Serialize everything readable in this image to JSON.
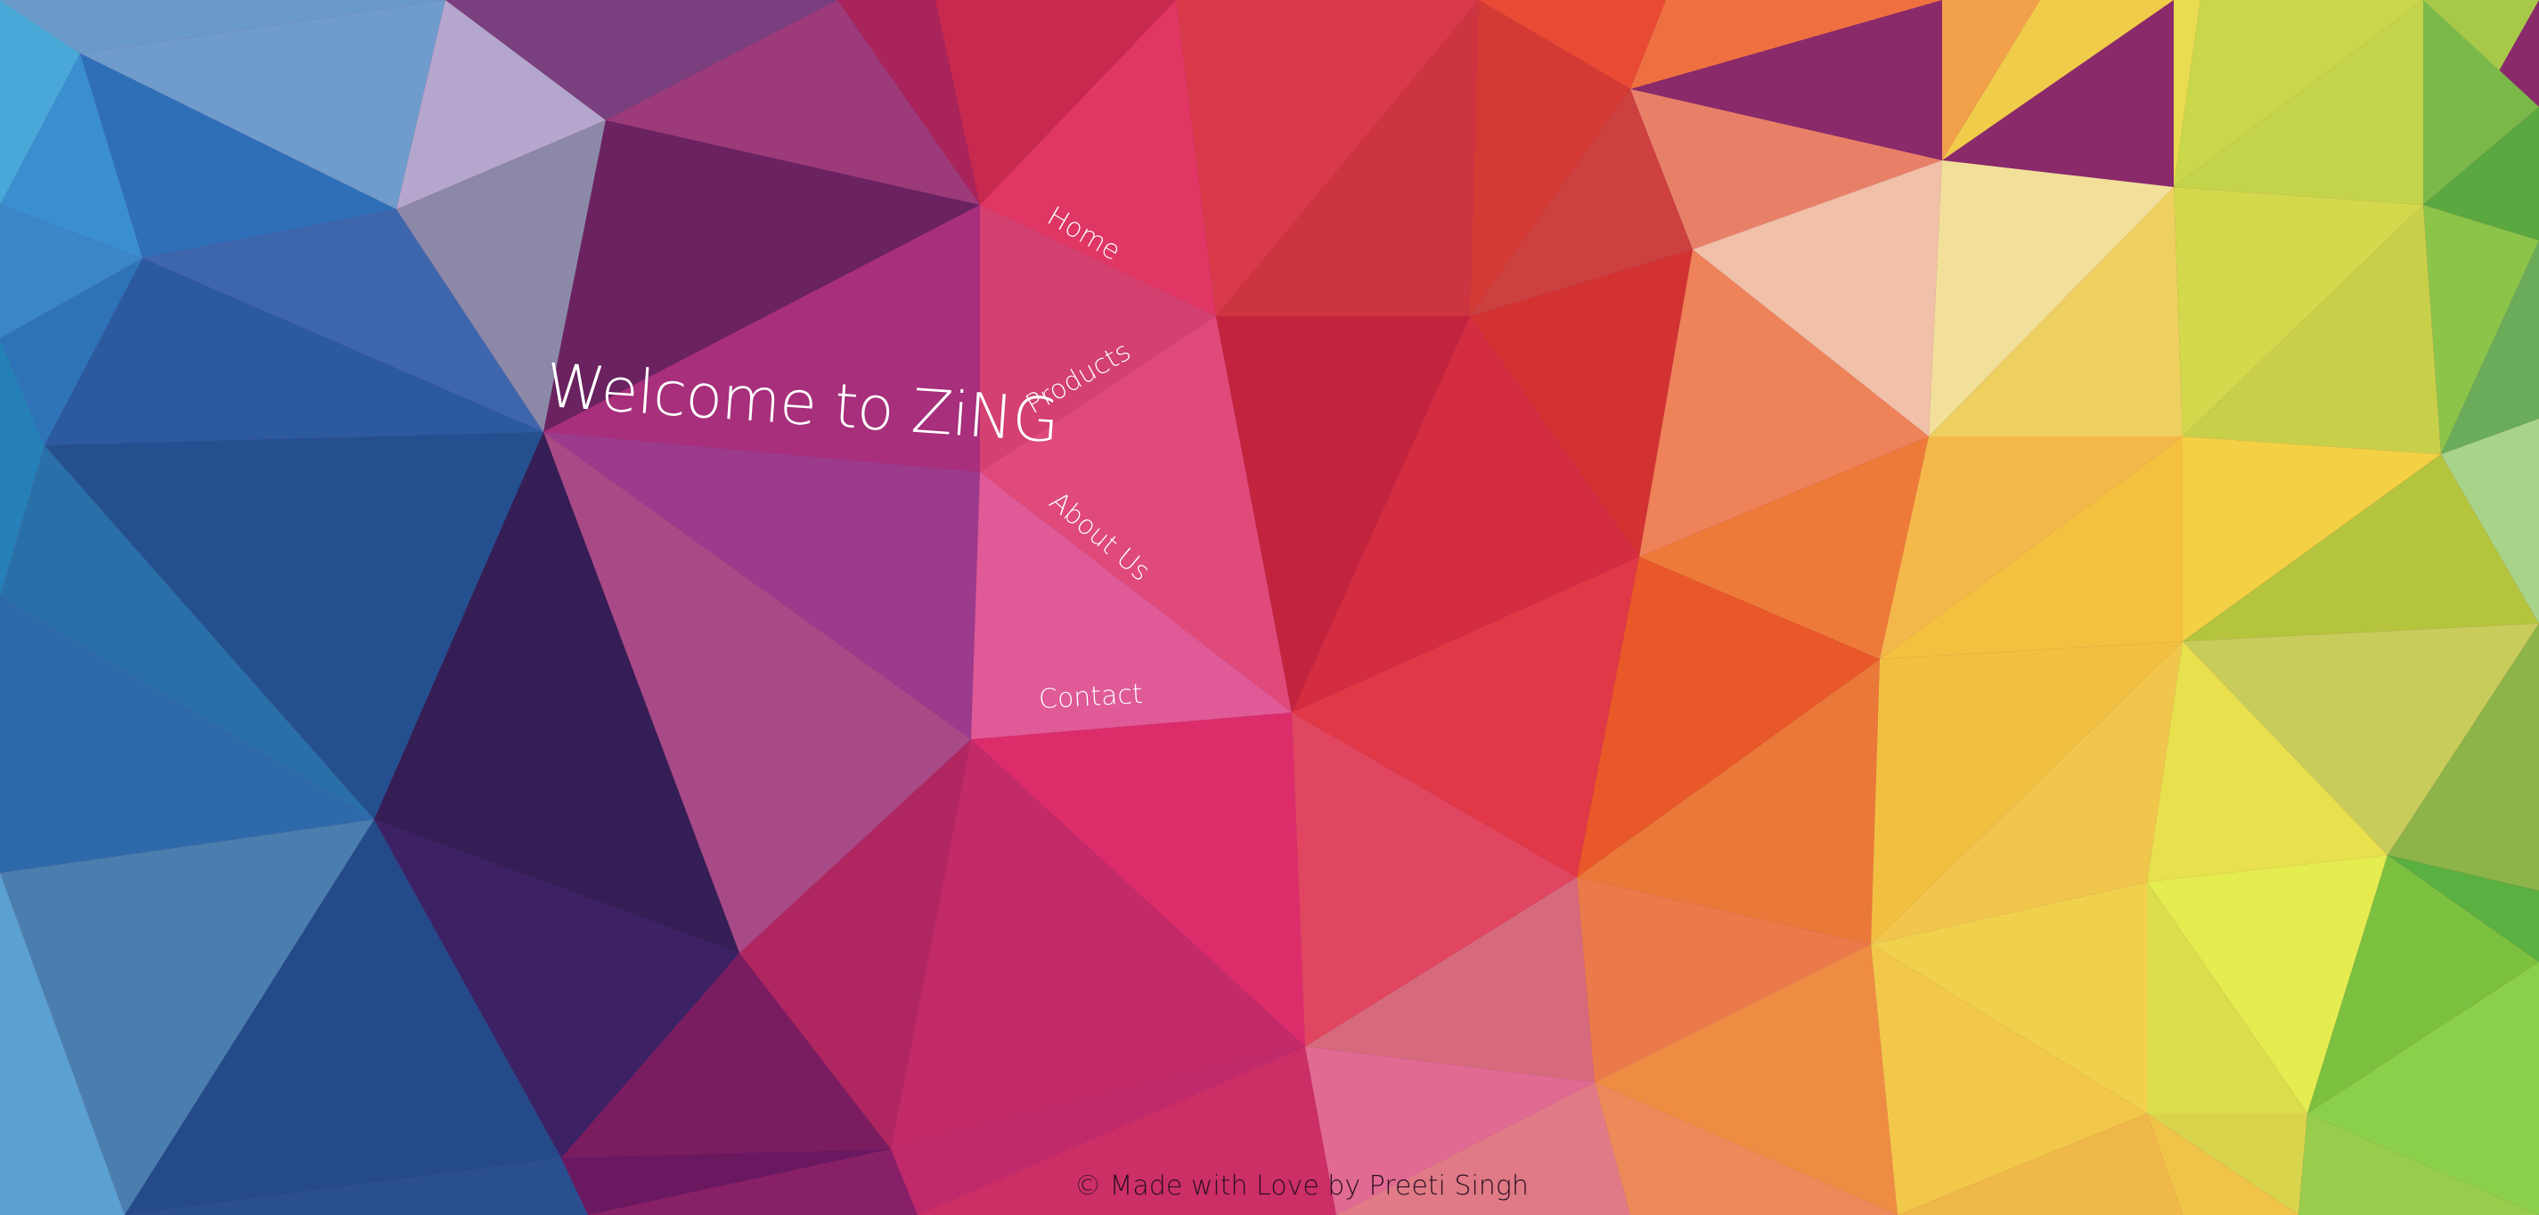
{
  "hero": {
    "title": "Welcome to ZiNG"
  },
  "nav": {
    "home": "Home",
    "products": "Products",
    "about": "About Us",
    "contact": "Contact"
  },
  "footer": {
    "text": "© Made with Love by Preeti Singh"
  },
  "background": {
    "style": "low-poly triangle mosaic",
    "palette": [
      "#3a8fd0",
      "#2c5aa0",
      "#5a2a6a",
      "#a03080",
      "#e0306a",
      "#e84a3a",
      "#f08a3a",
      "#f5c840",
      "#c8d84a",
      "#5ab040"
    ]
  }
}
